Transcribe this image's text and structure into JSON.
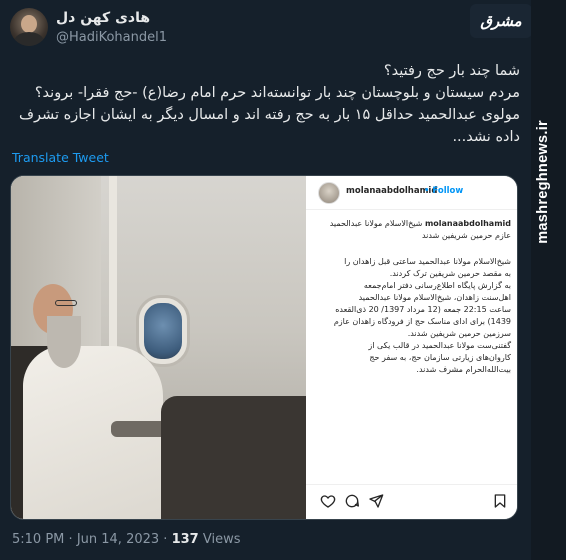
{
  "author": {
    "display_name": "هادی کهن دل",
    "handle": "@HadiKohandel1"
  },
  "brand": {
    "logo_text": "مشرق",
    "watermark": "mashreghnews.ir"
  },
  "tweet": {
    "lines": [
      "شما چند بار حج رفتید؟",
      "مردم سیستان و بلوچستان چند بار توانسته‌اند حرم امام رضا(ع) -حج فقرا- بروند؟",
      "مولوی عبدالحمید حداقل ۱۵ بار به حج رفته اند و امسال دیگر به ایشان اجازه تشرف داده نشد..."
    ],
    "translate_label": "Translate Tweet",
    "time": "5:10 PM",
    "separator": "·",
    "date": "Jun 14, 2023",
    "views_count": "137",
    "views_label": "Views"
  },
  "instagram_post": {
    "username": "molanaabdolhamid",
    "follow_label": "Follow",
    "caption_user": "molanaabdolhamid",
    "caption_head": "شیخ‌الاسلام مولانا عبدالحمید عازم حرمین شریفین شدند",
    "caption_body": [
      "شیخ‌الاسلام مولانا عبدالحمید ساعتی قبل زاهدان را",
      "به مقصد حرمین شریفین ترک کردند.",
      "به گزارش پایگاه اطلاع‌رسانی دفتر امام‌جمعه",
      "اهل‌سنت زاهدان، شیخ‌الاسلام مولانا عبدالحمید",
      "ساعت 22:15 جمعه (12 مرداد 1397/ 20 ذی‌القعده",
      "1439) برای ادای مناسک حج از فرودگاه زاهدان عازم",
      "سرزمین حرمین شریفین شدند.",
      "گفتنی‌ست مولانا عبدالحمید در قالب یکی از",
      "کاروان‌های زیارتی سازمان حج، به سفر حج",
      "بیت‌الله‌الحرام مشرف شدند."
    ],
    "icons": [
      "heart-icon",
      "comment-icon",
      "share-icon",
      "bookmark-icon"
    ]
  },
  "colors": {
    "background": "#15202b",
    "text": "#e7e9ea",
    "muted": "#8b98a5",
    "link": "#1d9bf0",
    "instagram_follow": "#0095f6"
  }
}
